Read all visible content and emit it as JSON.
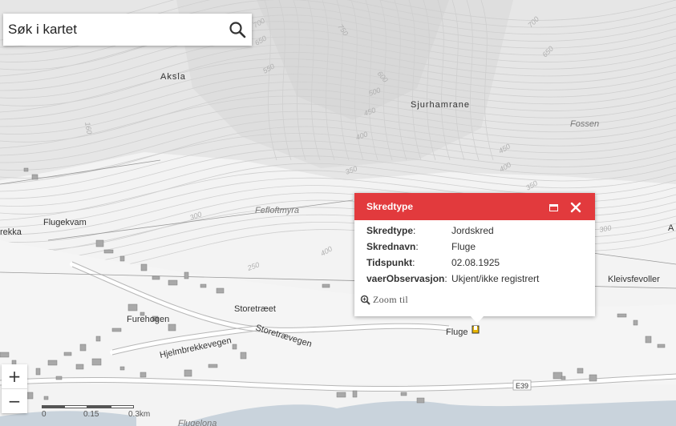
{
  "search": {
    "placeholder": "Søk i kartet"
  },
  "zoom": {
    "in_label": "+",
    "out_label": "−"
  },
  "scalebar": {
    "labels": [
      "0",
      "0.15",
      "0.3km"
    ]
  },
  "popup": {
    "title": "Skredtype",
    "rows": [
      {
        "key": "Skredtype",
        "value": "Jordskred"
      },
      {
        "key": "Skrednavn",
        "value": "Fluge"
      },
      {
        "key": "Tidspunkt",
        "value": "02.08.1925"
      },
      {
        "key": "vaerObservasjon",
        "value": "Ukjent/ikke registrert"
      }
    ],
    "zoom_link": "Zoom til"
  },
  "map": {
    "place_labels": [
      "Aksla",
      "Sjurhamrane",
      "Fossen",
      "Flugekvam",
      "rekka",
      "Fefloftmyra",
      "Storetræet",
      "Furehogen",
      "Storetrævegen",
      "Hjelmbrekkevegen",
      "Kleivsfevoller",
      "Fluge",
      "Flugelona",
      "A"
    ],
    "contour_labels": [
      "750",
      "700",
      "650",
      "600",
      "550",
      "500",
      "450",
      "400",
      "350",
      "300",
      "250",
      "160",
      "550",
      "650",
      "700",
      "450",
      "400",
      "350",
      "300",
      "400"
    ],
    "road_label": "E39"
  },
  "colors": {
    "popup_header": "#e23a3d",
    "water": "#c9d3dc",
    "marker": "#e8b500"
  }
}
